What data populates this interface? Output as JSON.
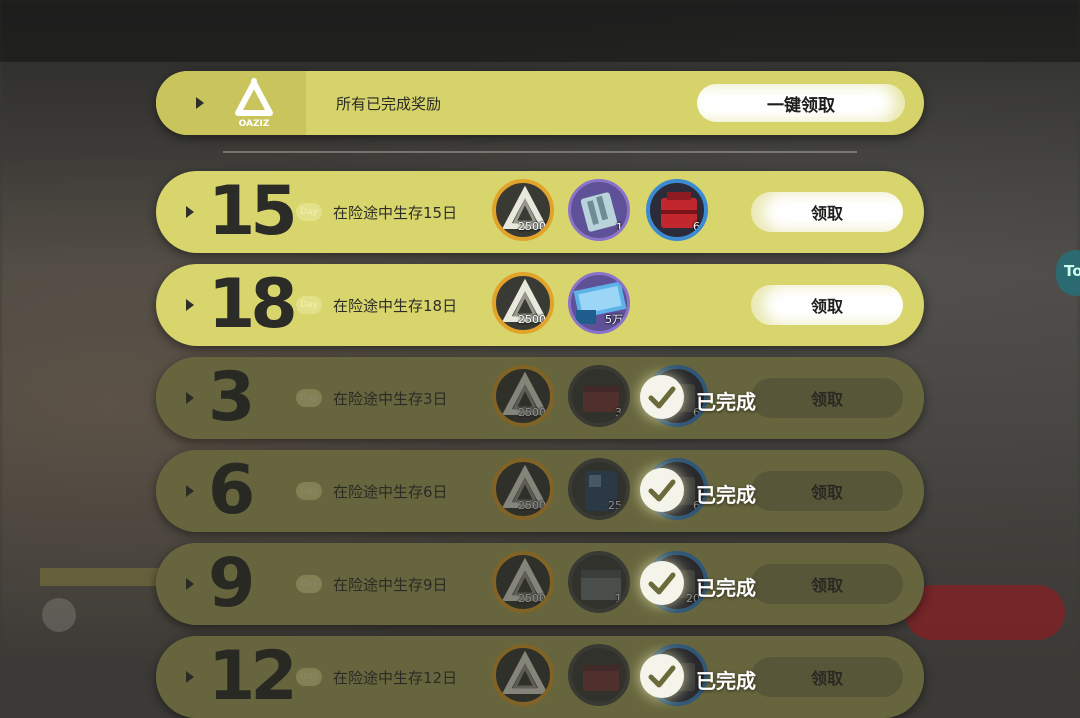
{
  "header": {
    "logo_text": "OAZIZ",
    "title": "所有已完成奖励",
    "claim_all_label": "一键领取"
  },
  "day_badge": "Day",
  "rows": [
    {
      "day": "15",
      "desc": "在险途中生存15日",
      "claim_label": "领取",
      "items": [
        {
          "icon": "oaziz-token-icon",
          "qty": "2500"
        },
        {
          "icon": "battery-pack-icon",
          "qty": "1"
        },
        {
          "icon": "red-toolbox-icon",
          "qty": "6"
        }
      ]
    },
    {
      "day": "18",
      "desc": "在险途中生存18日",
      "claim_label": "领取",
      "items": [
        {
          "icon": "oaziz-token-icon",
          "qty": "2500"
        },
        {
          "icon": "cash-bundle-icon",
          "qty": "5万"
        }
      ]
    },
    {
      "day": "3",
      "desc": "在险途中生存3日",
      "claim_label": "领取",
      "done_label": "已完成",
      "items": [
        {
          "icon": "oaziz-token-icon",
          "qty": "2500"
        },
        {
          "icon": "supply-crate-icon",
          "qty": "3"
        },
        {
          "icon": "supply-box-icon",
          "qty": "6"
        }
      ]
    },
    {
      "day": "6",
      "desc": "在险途中生存6日",
      "claim_label": "领取",
      "done_label": "已完成",
      "items": [
        {
          "icon": "oaziz-token-icon",
          "qty": "2500"
        },
        {
          "icon": "manual-book-icon",
          "qty": "25"
        },
        {
          "icon": "supply-box-icon",
          "qty": "6"
        }
      ]
    },
    {
      "day": "9",
      "desc": "在险途中生存9日",
      "claim_label": "领取",
      "done_label": "已完成",
      "items": [
        {
          "icon": "oaziz-token-icon",
          "qty": "2500"
        },
        {
          "icon": "metal-chest-icon",
          "qty": "1"
        },
        {
          "icon": "supply-box-icon",
          "qty": "20"
        }
      ]
    },
    {
      "day": "12",
      "desc": "在险途中生存12日",
      "claim_label": "领取",
      "done_label": "已完成",
      "items": [
        {
          "icon": "oaziz-token-icon",
          "qty": ""
        },
        {
          "icon": "supply-crate-icon",
          "qty": ""
        },
        {
          "icon": "supply-box-icon",
          "qty": ""
        }
      ]
    }
  ],
  "side_tab_label": "To"
}
